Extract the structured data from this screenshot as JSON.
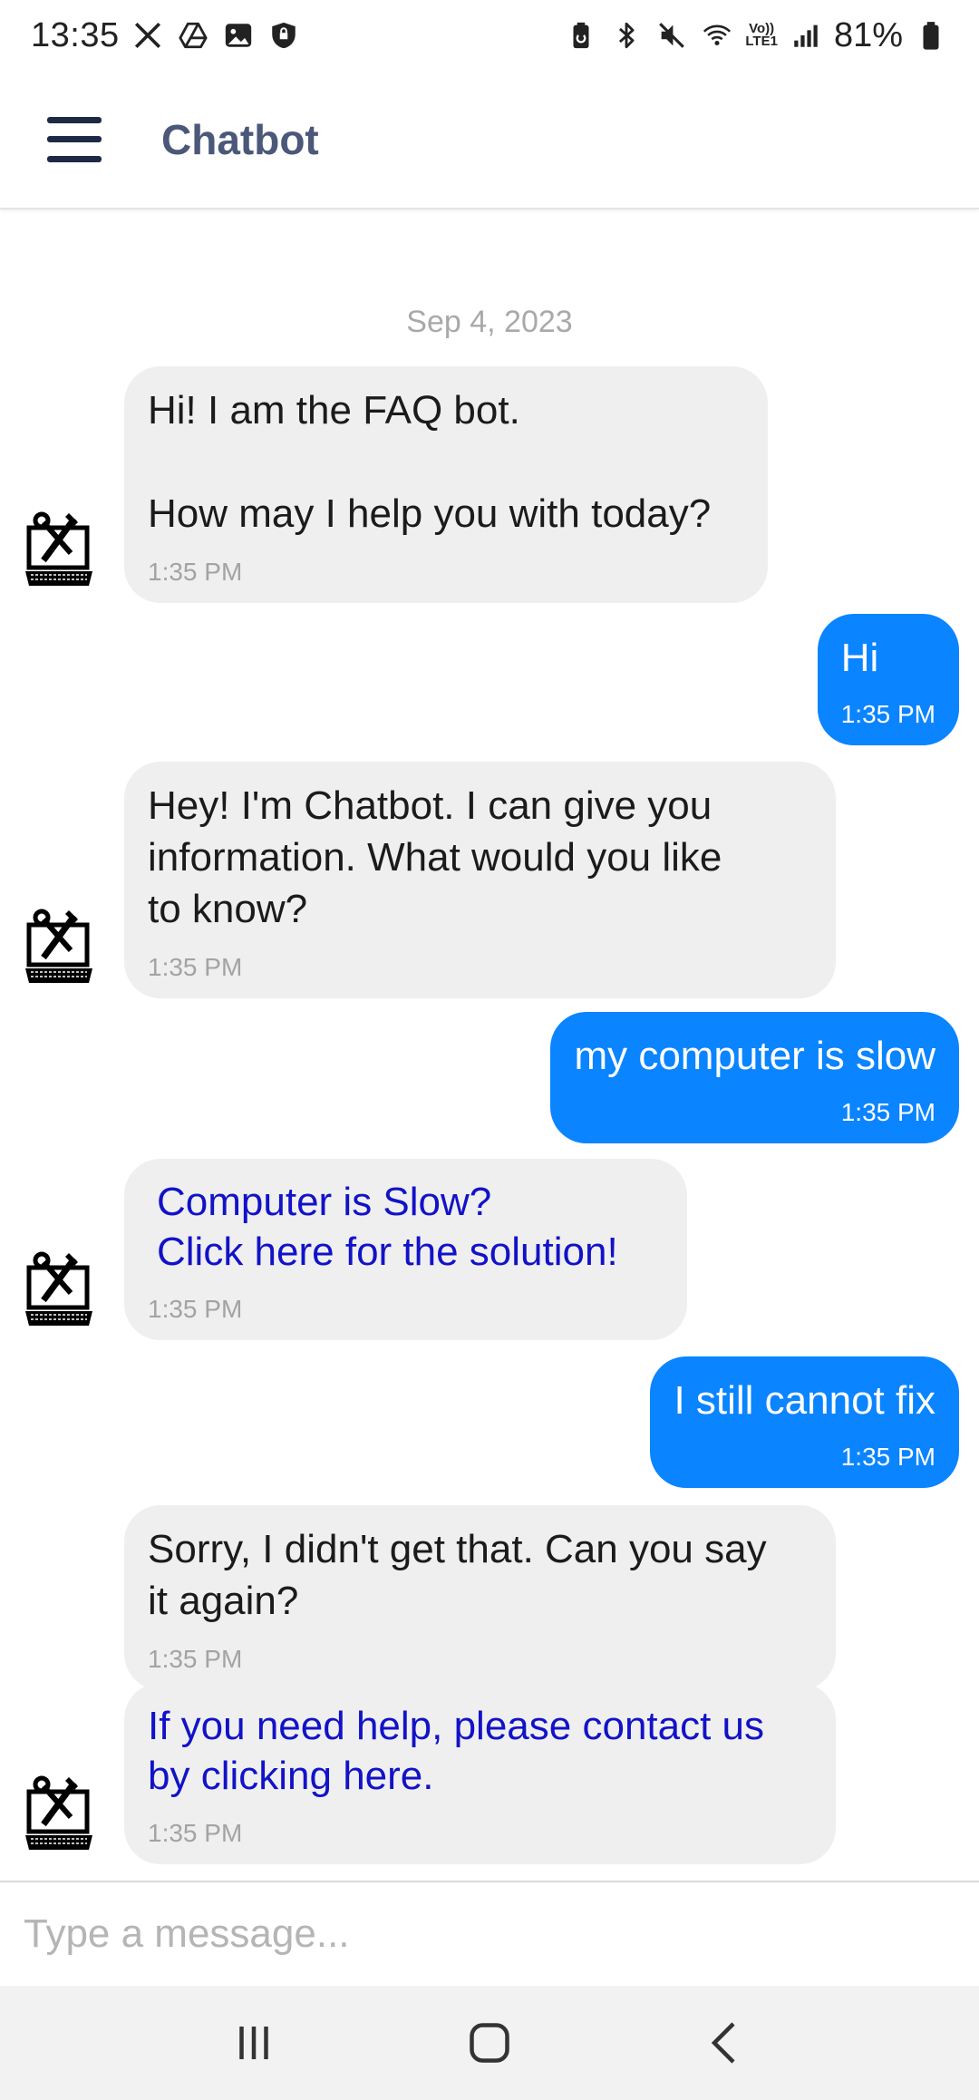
{
  "status_bar": {
    "time": "13:35",
    "battery": "81%",
    "left_icons": [
      "x-icon",
      "drive-icon",
      "gallery-icon",
      "shield-icon"
    ],
    "right_icons": [
      "battery-saver-icon",
      "bluetooth-icon",
      "mute-icon",
      "wifi-6-icon",
      "volte-icon",
      "signal-icon",
      "battery-icon"
    ],
    "volte_line1": "Vo))",
    "volte_line2": "LTE1"
  },
  "app_bar": {
    "title": "Chatbot"
  },
  "chat": {
    "date": "Sep 4, 2023",
    "messages": [
      {
        "sender": "bot",
        "text": "Hi! I am the FAQ bot.\n\nHow may I help you with today?",
        "time": "1:35 PM"
      },
      {
        "sender": "user",
        "text": "Hi",
        "time": "1:35 PM"
      },
      {
        "sender": "bot",
        "text": "Hey! I'm Chatbot. I can give you\ninformation. What would you like\nto know?",
        "time": "1:35 PM"
      },
      {
        "sender": "user",
        "text": "my computer is slow",
        "time": "1:35 PM"
      },
      {
        "sender": "bot",
        "text": "Computer is Slow?\nClick here for the solution!",
        "time": "1:35 PM",
        "is_link": true
      },
      {
        "sender": "user",
        "text": "I still cannot fix",
        "time": "1:35 PM"
      },
      {
        "sender": "bot",
        "text": "Sorry, I didn't get that. Can you say\nit again?",
        "time": "1:35 PM"
      },
      {
        "sender": "bot",
        "text": "If you need help, please contact us\nby clicking here.",
        "time": "1:35 PM",
        "is_link": true
      }
    ]
  },
  "input": {
    "placeholder": "Type a message..."
  },
  "nav_bar": {
    "buttons": [
      "recents-icon",
      "home-icon",
      "back-icon"
    ]
  },
  "colors": {
    "user_bubble": "#0a84ff",
    "bot_bubble": "#efefef",
    "link": "#1212c8",
    "title": "#4b5879"
  }
}
